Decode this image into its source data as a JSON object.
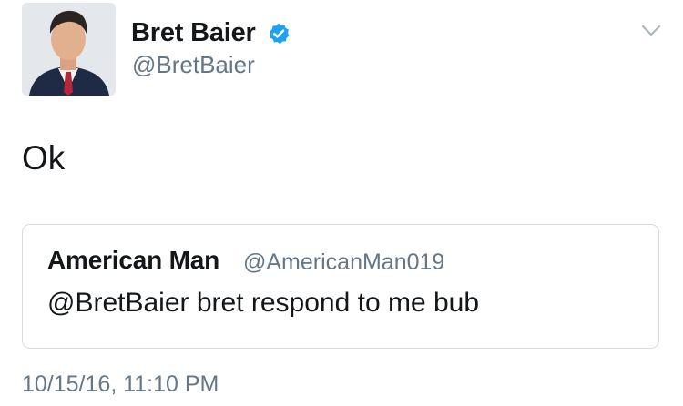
{
  "author": {
    "display_name": "Bret Baier",
    "handle": "@BretBaier",
    "verified": true
  },
  "tweet": {
    "text": "Ok",
    "timestamp": "10/15/16, 11:10 PM"
  },
  "quoted_tweet": {
    "display_name": "American Man",
    "handle": "@AmericanMan019",
    "text": "@BretBaier bret respond to me bub"
  },
  "icons": {
    "verified": "verified-badge-icon",
    "menu": "chevron-down-icon"
  },
  "colors": {
    "primary_text": "#14171a",
    "secondary_text": "#657786",
    "verified_blue": "#1da1f2",
    "card_border": "#d6dbe0"
  }
}
